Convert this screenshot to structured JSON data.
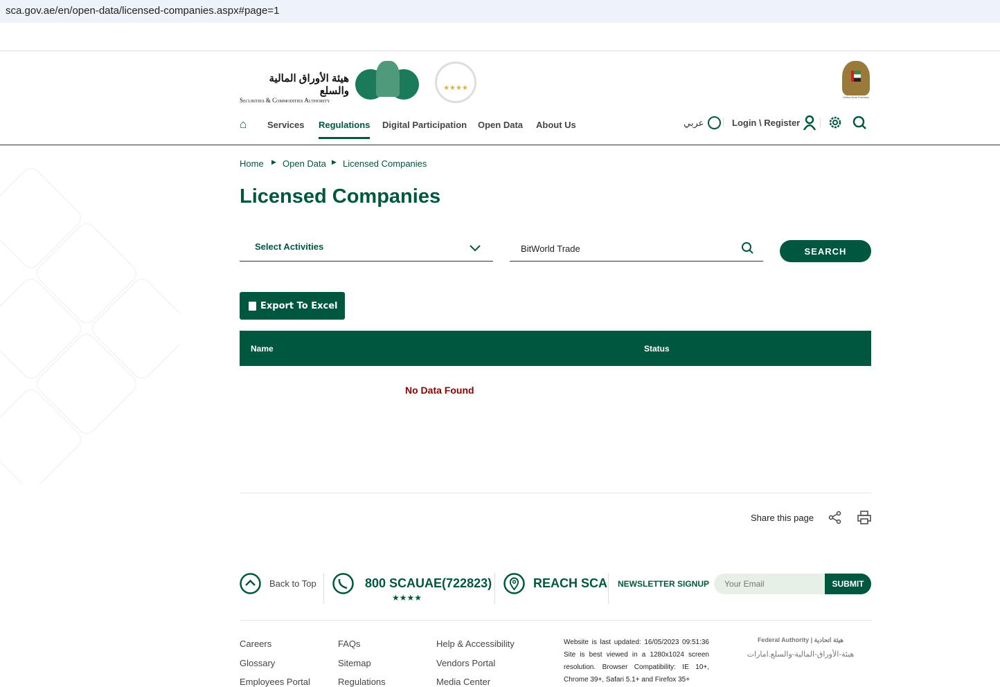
{
  "browser": {
    "url": "sca.gov.ae/en/open-data/licensed-companies.aspx#page=1"
  },
  "header": {
    "logo_arabic": "هيئة الأوراق المالية والسلع",
    "logo_english": "Securities & Commodities Authority",
    "uae_emblem_caption": "United Arab Emirates",
    "nav": [
      "Services",
      "Regulations",
      "Digital Participation",
      "Open Data",
      "About Us"
    ],
    "language": "عربي",
    "login": "Login \\ Register"
  },
  "breadcrumb": [
    "Home",
    "Open Data",
    "Licensed Companies"
  ],
  "page_title": "Licensed Companies",
  "filters": {
    "activities_label": "Select Activities",
    "search_value": "BitWorld Trade",
    "search_button": "SEARCH"
  },
  "export_label": "Export To Excel",
  "table": {
    "columns": [
      "Name",
      "Status"
    ],
    "empty": "No Data Found"
  },
  "share": {
    "label": "Share this page"
  },
  "footer": {
    "back_to_top": "Back to Top",
    "phone": "800 SCAUAE(722823)",
    "stars": "★★★★",
    "reach": "REACH SCA",
    "newsletter": "NEWSLETTER SIGNUP",
    "email_placeholder": "Your Email",
    "submit": "SUBMIT",
    "links": [
      [
        "Careers",
        "Glossary",
        "Employees Portal"
      ],
      [
        "FAQs",
        "Sitemap",
        "Regulations"
      ],
      [
        "Help & Accessibility",
        "Vendors Portal",
        "Media Center"
      ]
    ],
    "info": "Website is last updated: 16/05/2023 09:51:36 Site is best viewed in a 1280x1024 screen resolution. Browser Compatibility: IE 10+, Chrome 39+, Safari 5.1+ and Firefox 35+",
    "federal": "Federal Authority | هيئة اتحادية",
    "federal_ar": "هيئة-الأوراق-المالية-والسلع.امارات"
  },
  "colors": {
    "brand": "#00573f",
    "error": "#8b0000"
  }
}
